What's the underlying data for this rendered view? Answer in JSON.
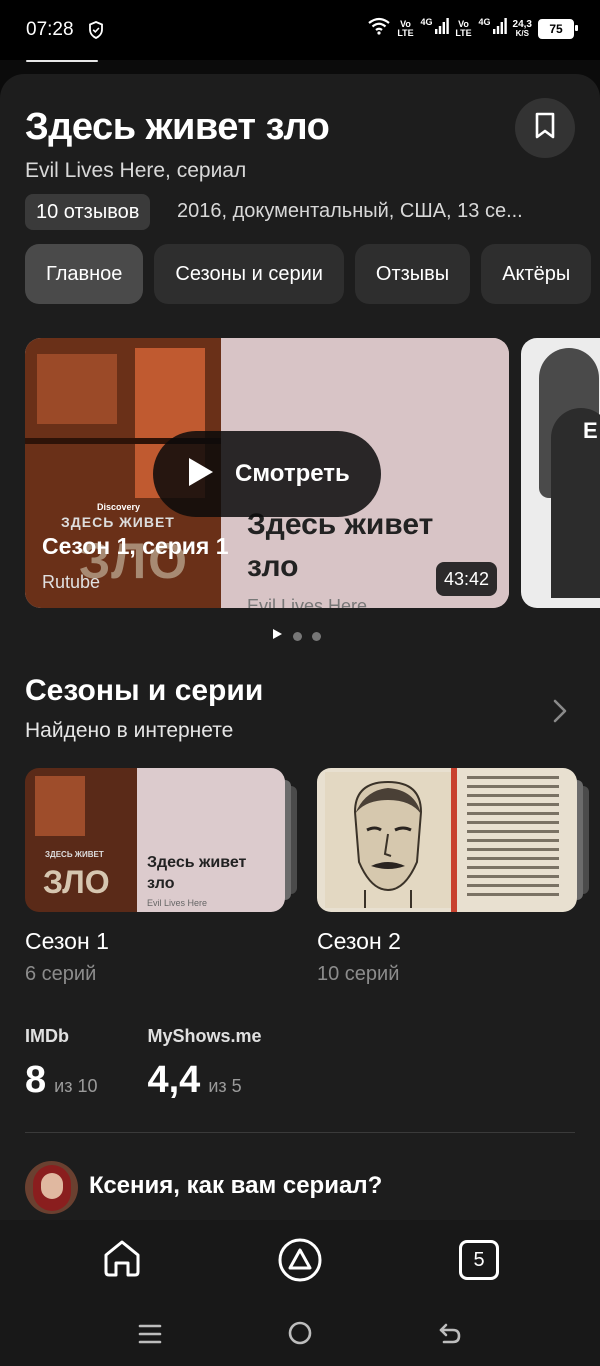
{
  "status_bar": {
    "time": "07:28",
    "volte1": "Vo\nLTE",
    "net1": "4G",
    "volte2": "Vo\nLTE",
    "net2": "4G",
    "speed_value": "24,3",
    "speed_unit": "K/S",
    "battery": "75"
  },
  "header": {
    "title": "Здесь живет зло",
    "subtitle": "Evil Lives Here, сериал",
    "reviews_chip": "10 отзывов",
    "meta": "2016, документальный, США, 13 се..."
  },
  "tabs": [
    {
      "label": "Главное",
      "active": true
    },
    {
      "label": "Сезоны и серии",
      "active": false
    },
    {
      "label": "Отзывы",
      "active": false
    },
    {
      "label": "Актёры",
      "active": false
    }
  ],
  "featured_video": {
    "watch_label": "Смотреть",
    "episode_title": "Сезон 1, серия 1",
    "source": "Rutube",
    "duration": "43:42",
    "poster_title_line1": "Здесь живет",
    "poster_title_line2": "зло",
    "poster_subtitle": "Evil Lives Here",
    "poster_channel": "Discovery",
    "poster_small_title": "ЗДЕСЬ ЖИВЕТ",
    "poster_big_word": "ЗЛО"
  },
  "second_video": {
    "letter": "E"
  },
  "pager": {
    "count": 3,
    "active": 0
  },
  "seasons_section": {
    "title": "Сезоны и серии",
    "subtitle": "Найдено в интернете",
    "seasons": [
      {
        "name": "Сезон 1",
        "count": "6 серий",
        "thumb_text_line1": "Здесь живет",
        "thumb_text_line2": "зло",
        "thumb_sub": "Evil Lives Here",
        "thumb_word": "ЗЛО",
        "thumb_small": "ЗДЕСЬ ЖИВЕТ"
      },
      {
        "name": "Сезон 2",
        "count": "10 серий"
      }
    ]
  },
  "ratings": [
    {
      "source": "IMDb",
      "value": "8",
      "scale": "из 10"
    },
    {
      "source": "MyShows.me",
      "value": "4,4",
      "scale": "из 5"
    }
  ],
  "prompt": {
    "question": "Ксения, как вам сериал?"
  },
  "bottom_nav": {
    "tabs_count": "5"
  },
  "colors": {
    "background": "#0b0b0b",
    "sheet": "#1d1d1d",
    "chip": "#2e2e2e",
    "chip_active": "#4a4a4a"
  }
}
